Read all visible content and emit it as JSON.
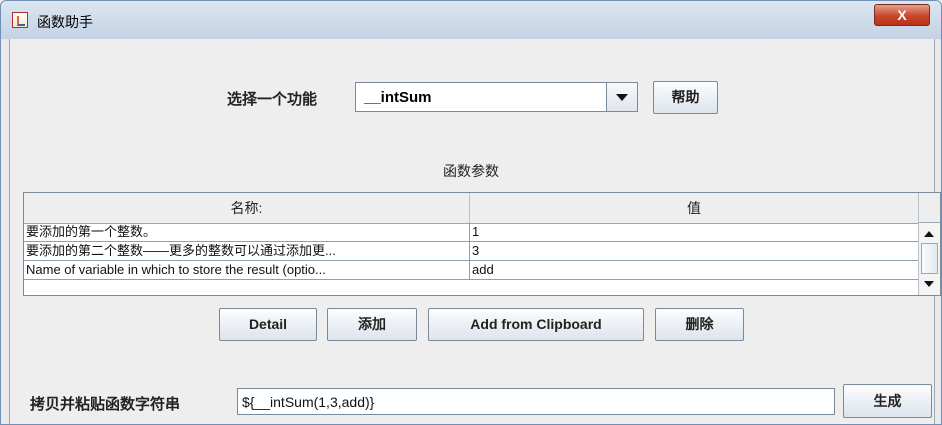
{
  "window": {
    "title": "函数助手",
    "close_label": "X"
  },
  "function_selector": {
    "label": "选择一个功能",
    "selected": "__intSum",
    "help_button": "帮助"
  },
  "params": {
    "section_title": "函数参数",
    "columns": [
      "名称:",
      "值"
    ],
    "rows": [
      {
        "name": "要添加的第一个整数。",
        "value": "1"
      },
      {
        "name": "要添加的第二个整数——更多的整数可以通过添加更...",
        "value": "3"
      },
      {
        "name": "Name of variable in which to store the result (optio...",
        "value": "add"
      }
    ]
  },
  "buttons": {
    "detail": "Detail",
    "add": "添加",
    "add_clipboard": "Add from Clipboard",
    "delete": "删除"
  },
  "output": {
    "label": "拷贝并粘贴函数字符串",
    "value": "${__intSum(1,3,add)}",
    "generate_button": "生成"
  },
  "colors": {
    "title_bar": "#c3d2e4",
    "close_button": "#c9462b",
    "background": "#eeeeee"
  }
}
